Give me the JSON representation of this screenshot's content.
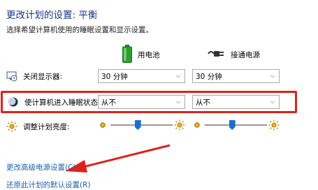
{
  "header": {
    "title": "更改计划的设置: 平衡",
    "subtitle": "选择希望计算机使用的睡眠设置和显示设置。"
  },
  "columns": {
    "battery_label": "用电池",
    "plugged_label": "接通电源"
  },
  "rows": {
    "display_off": {
      "label": "关闭显示器:",
      "battery_value": "30 分钟",
      "plugged_value": "30 分钟"
    },
    "sleep": {
      "label": "使计算机进入睡眠状态:",
      "battery_value": "从不",
      "plugged_value": "从不"
    },
    "brightness": {
      "label": "调整计划亮度:",
      "battery_level": 0.44,
      "plugged_level": 0.44
    }
  },
  "links": {
    "advanced": "更改高级电源设置(C)",
    "restore": "还原此计划的默认设置(R)"
  },
  "colors": {
    "title": "#1e3287",
    "link": "#1a5fb4",
    "highlight": "#e0201b",
    "slider_thumb": "#1a6fd0"
  }
}
